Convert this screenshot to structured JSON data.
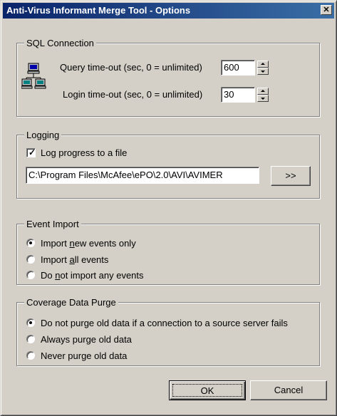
{
  "window": {
    "title": "Anti-Virus Informant Merge Tool - Options",
    "close_glyph": "✕"
  },
  "sql_connection": {
    "label": "SQL Connection",
    "icon": "network-computers-icon",
    "query_timeout_label": "Query time-out (sec, 0 = unlimited)",
    "query_timeout_value": "600",
    "login_timeout_label": "Login time-out (sec, 0 = unlimited)",
    "login_timeout_value": "30"
  },
  "logging": {
    "label": "Logging",
    "log_checkbox_checked": true,
    "log_checkbox_label": "Log progress to a file",
    "log_path": "C:\\Program Files\\McAfee\\ePO\\2.0\\AVI\\AVIMER",
    "browse_label": ">>"
  },
  "event_import": {
    "label": "Event Import",
    "options": [
      {
        "pre": "Import ",
        "accel": "n",
        "post": "ew events only",
        "selected": true
      },
      {
        "pre": "Import ",
        "accel": "a",
        "post": "ll events",
        "selected": false
      },
      {
        "pre": "Do ",
        "accel": "n",
        "post": "ot import any events",
        "selected": false
      }
    ]
  },
  "coverage_purge": {
    "label": "Coverage Data Purge",
    "options": [
      {
        "text": "Do not purge old data if a connection to a source server fails",
        "selected": true
      },
      {
        "text": "Always purge old data",
        "selected": false
      },
      {
        "text": "Never purge old data",
        "selected": false
      }
    ]
  },
  "footer": {
    "ok_label": "OK",
    "cancel_label": "Cancel"
  },
  "colors": {
    "face": "#d4d0c8",
    "title_start": "#0a246a",
    "title_end": "#3a6ea5"
  }
}
